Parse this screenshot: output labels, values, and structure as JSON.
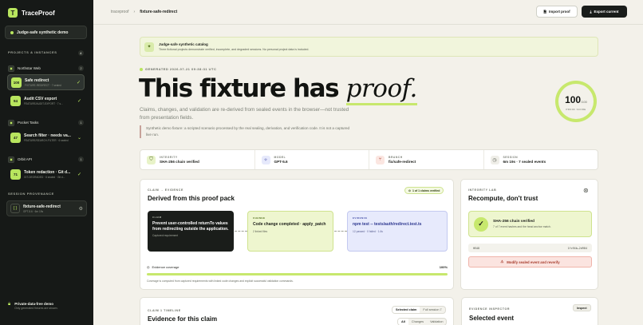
{
  "app": {
    "name": "TraceProof",
    "logo_glyph": "T"
  },
  "sidebar": {
    "demo_pill": "Judge-safe synthetic demo",
    "projects_heading": "PROJECTS & INSTANCES",
    "projects_count": "4",
    "projects": [
      {
        "name": "Northstar Web",
        "count": "2",
        "fixtures": [
          {
            "badge": "100",
            "title": "Safe redirect",
            "sub": "FIXTURE-REDIRECT · 7 sealed",
            "active": true
          },
          {
            "badge": "94",
            "title": "Audit CSV export",
            "sub": "FEATURE/AUDIT-EXPORT · 7 s...",
            "active": false
          }
        ]
      },
      {
        "name": "Pocket Tasks",
        "count": "1",
        "fixtures": [
          {
            "badge": "47",
            "title": "Search filter · needs va...",
            "sub": "FEATURE/SEARCH-FILTER · 6 sealed",
            "active": false
          }
        ]
      },
      {
        "name": "Orbit API",
        "count": "1",
        "fixtures": [
          {
            "badge": "71",
            "title": "Token redaction · Git d...",
            "sub": "GIT-DEGRADED · 6 sealed · Git d...",
            "active": false
          }
        ]
      }
    ],
    "provenance_heading": "SESSION PROVENANCE",
    "provenance": {
      "title": "fixture-safe-redirect",
      "sub": "GPT-5.6 · 6m 19s"
    },
    "footer": {
      "title": "Private-data-free demo",
      "sub": "Only generated fixtures are shown."
    }
  },
  "header": {
    "breadcrumb_root": "traceproof",
    "breadcrumb_sep": "›",
    "breadcrumb_current": "fixture-safe-redirect",
    "import_label": "Import proof",
    "export_label": "Export current"
  },
  "notice": {
    "title": "Judge-safe synthetic catalog",
    "text": "Three fictional projects demonstrate verified, incomplete, and degraded sessions. No personal project data is included."
  },
  "hero": {
    "generated": "GENERATED 2026-07-21 09:38:31 UTC",
    "title_main": "This fixture has",
    "title_em": "proof.",
    "subtitle": "Claims, changes, and validation are re-derived from sealed events in the browser—not trusted from presentation fields.",
    "note": "Synthetic demo fixture: a scripted scenario processed by the real sealing, derivation, and verification code. It is not a captured live run."
  },
  "score": {
    "value": "100",
    "max": "/100",
    "label": "PROOF SCORE",
    "fraction": 1.0
  },
  "meta": [
    {
      "key": "INTEGRITY",
      "value": "SHA-256 chain verified",
      "icon": "shield-check-icon",
      "color": "#e8f3c8",
      "fg": "#3d5710"
    },
    {
      "key": "MODEL",
      "value": "GPT-5.6",
      "icon": "sparkle-icon",
      "color": "#e6e9fb",
      "fg": "#4650a8"
    },
    {
      "key": "BRANCH",
      "value": "fix/safe-redirect",
      "icon": "branch-icon",
      "color": "#fbe6e1",
      "fg": "#b0463a"
    },
    {
      "key": "SESSION",
      "value": "6m 19s · 7 sealed events",
      "icon": "clock-icon",
      "color": "#efeee8",
      "fg": "#55594f"
    }
  ],
  "claim": {
    "kicker": "CLAIM → EVIDENCE",
    "title": "Derived from this proof pack",
    "verified": "1 of 1 claims verified",
    "boxes": [
      {
        "kicker": "CLAIM",
        "title": "Prevent user-controlled returnTo values from redirecting outside the application.",
        "sub": "Captured requirement"
      },
      {
        "kicker": "CHANGE",
        "title": "Code change completed · apply_patch",
        "sub": "2 linked files"
      },
      {
        "kicker": "EVIDENCE",
        "title": "npm test -- tests/auth/redirect.test.ts",
        "sub": "12 passed · 0 failed · 1.6s"
      }
    ],
    "coverage_label": "Evidence coverage",
    "coverage_value": "100%",
    "coverage_fraction": 1.0,
    "coverage_note": "Coverage is computed from captured requirements with linked code changes and explicit successful validation commands."
  },
  "lab": {
    "kicker": "INTEGRITY LAB",
    "title": "Recompute, don't trust",
    "hash_title": "SHA-256 chain verified",
    "hash_sub": "7 of 7 event hashes and the head anchor match.",
    "head_label": "HEAD",
    "head_value": "1fc94b…2d984",
    "tamper_label": "Modify sealed event and reverify"
  },
  "timeline": {
    "kicker": "CLAIM 1 TIMELINE",
    "title": "Evidence for this claim",
    "scope_tabs": [
      "Selected claim",
      "Full session 7"
    ],
    "filter_tabs": [
      "All",
      "Changes",
      "Validation"
    ]
  },
  "inspector": {
    "kicker": "EVIDENCE INSPECTOR",
    "title": "Selected event",
    "inspect_label": "Inspect"
  }
}
